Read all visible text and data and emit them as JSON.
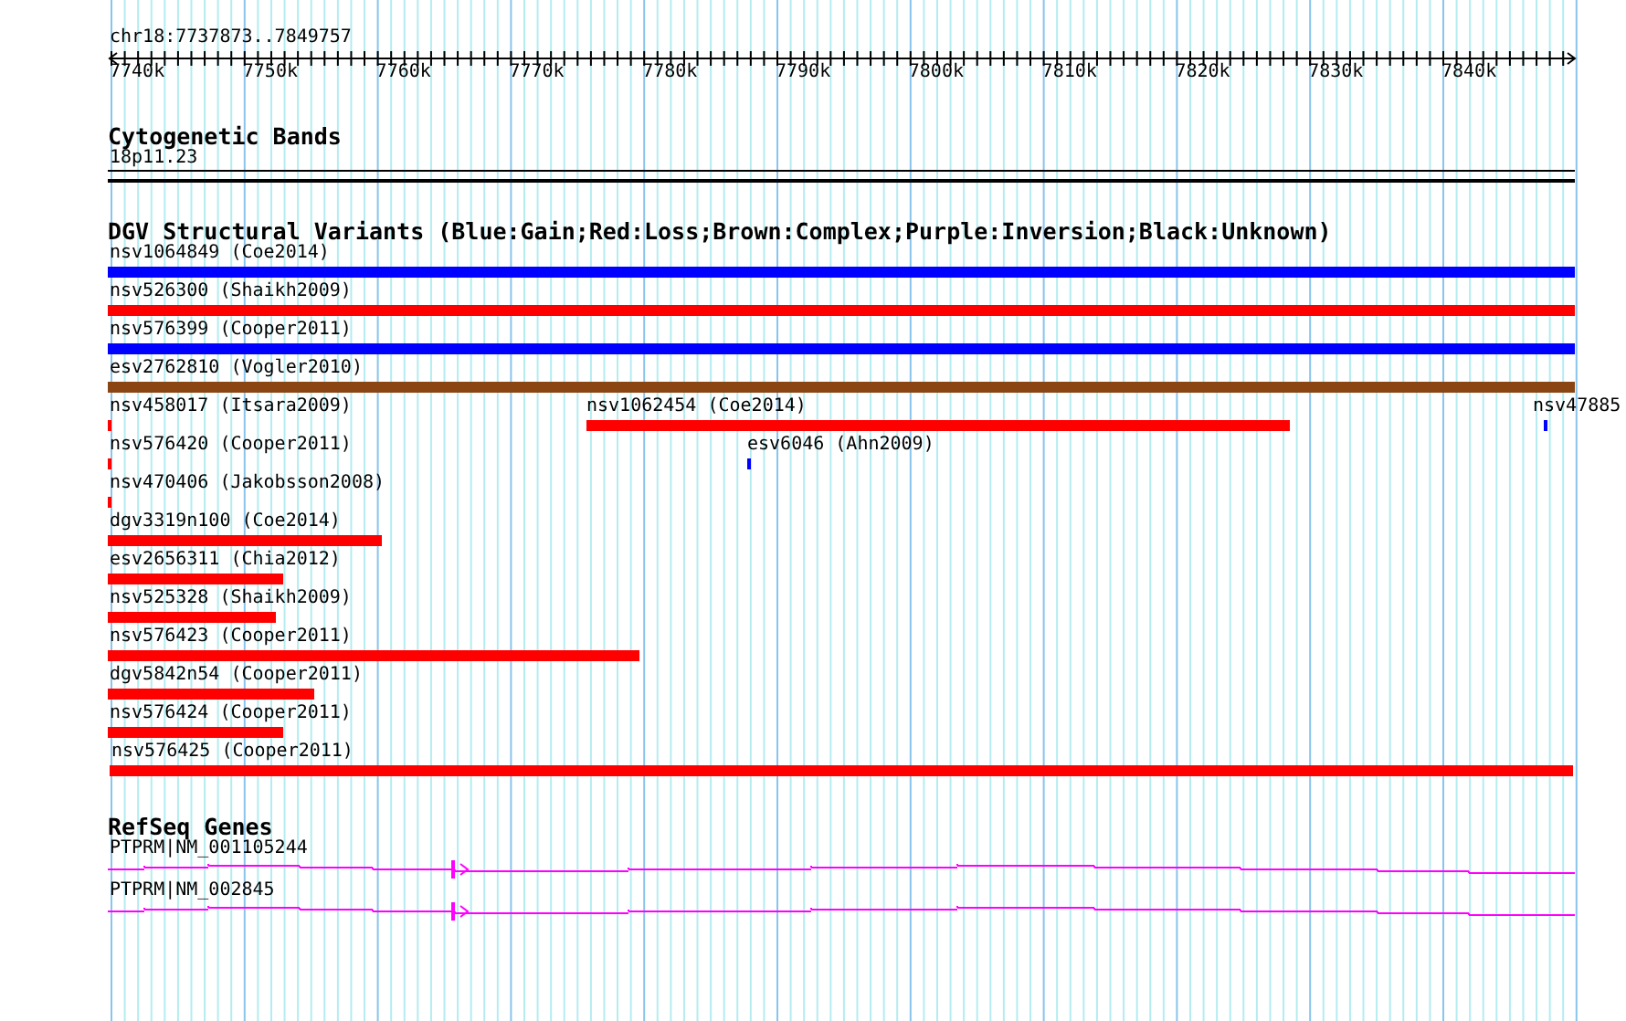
{
  "ruler": {
    "location": "chr18:7737873..7849757",
    "ticks": [
      "7740k",
      "7750k",
      "7760k",
      "7770k",
      "7780k",
      "7790k",
      "7800k",
      "7810k",
      "7820k",
      "7830k",
      "7840k"
    ]
  },
  "tracks": [
    {
      "kind": "cytoband",
      "title": "Cytogenetic Bands",
      "bands": [
        {
          "label": "18p11.23"
        }
      ]
    },
    {
      "kind": "variants",
      "title": "DGV Structural Variants (Blue:Gain;Red:Loss;Brown:Complex;Purple:Inversion;Black:Unknown)",
      "rows": [
        [
          {
            "label": "nsv1064849 (Coe2014)",
            "color": "#0000ff"
          }
        ],
        [
          {
            "label": "nsv526300 (Shaikh2009)",
            "color": "#ff0000"
          }
        ],
        [
          {
            "label": "nsv576399 (Cooper2011)",
            "color": "#0000ff"
          }
        ],
        [
          {
            "label": "esv2762810 (Vogler2010)",
            "color": "#8b4513"
          }
        ],
        [
          {
            "label": "nsv458017 (Itsara2009)",
            "color": "#ff0000"
          },
          {
            "label": "nsv1062454 (Coe2014)",
            "color": "#ff0000"
          },
          {
            "label": "nsv47885",
            "color": "#0000ff"
          }
        ],
        [
          {
            "label": "nsv576420 (Cooper2011)",
            "color": "#ff0000"
          },
          {
            "label": "esv6046 (Ahn2009)",
            "color": "#0000ff"
          }
        ],
        [
          {
            "label": "nsv470406 (Jakobsson2008)",
            "color": "#ff0000"
          }
        ],
        [
          {
            "label": "dgv3319n100 (Coe2014)",
            "color": "#ff0000"
          }
        ],
        [
          {
            "label": "esv2656311 (Chia2012)",
            "color": "#ff0000"
          }
        ],
        [
          {
            "label": "nsv525328 (Shaikh2009)",
            "color": "#ff0000"
          }
        ],
        [
          {
            "label": "nsv576423 (Cooper2011)",
            "color": "#ff0000"
          }
        ],
        [
          {
            "label": "dgv5842n54 (Cooper2011)",
            "color": "#ff0000"
          }
        ],
        [
          {
            "label": "nsv576424 (Cooper2011)",
            "color": "#ff0000"
          }
        ],
        [
          {
            "label": "nsv576425 (Cooper2011)",
            "color": "#ff0000"
          }
        ]
      ]
    },
    {
      "kind": "genes",
      "title": "RefSeq Genes",
      "genes": [
        {
          "label": "PTPRM|NM_001105244"
        },
        {
          "label": "PTPRM|NM_002845"
        }
      ]
    }
  ]
}
